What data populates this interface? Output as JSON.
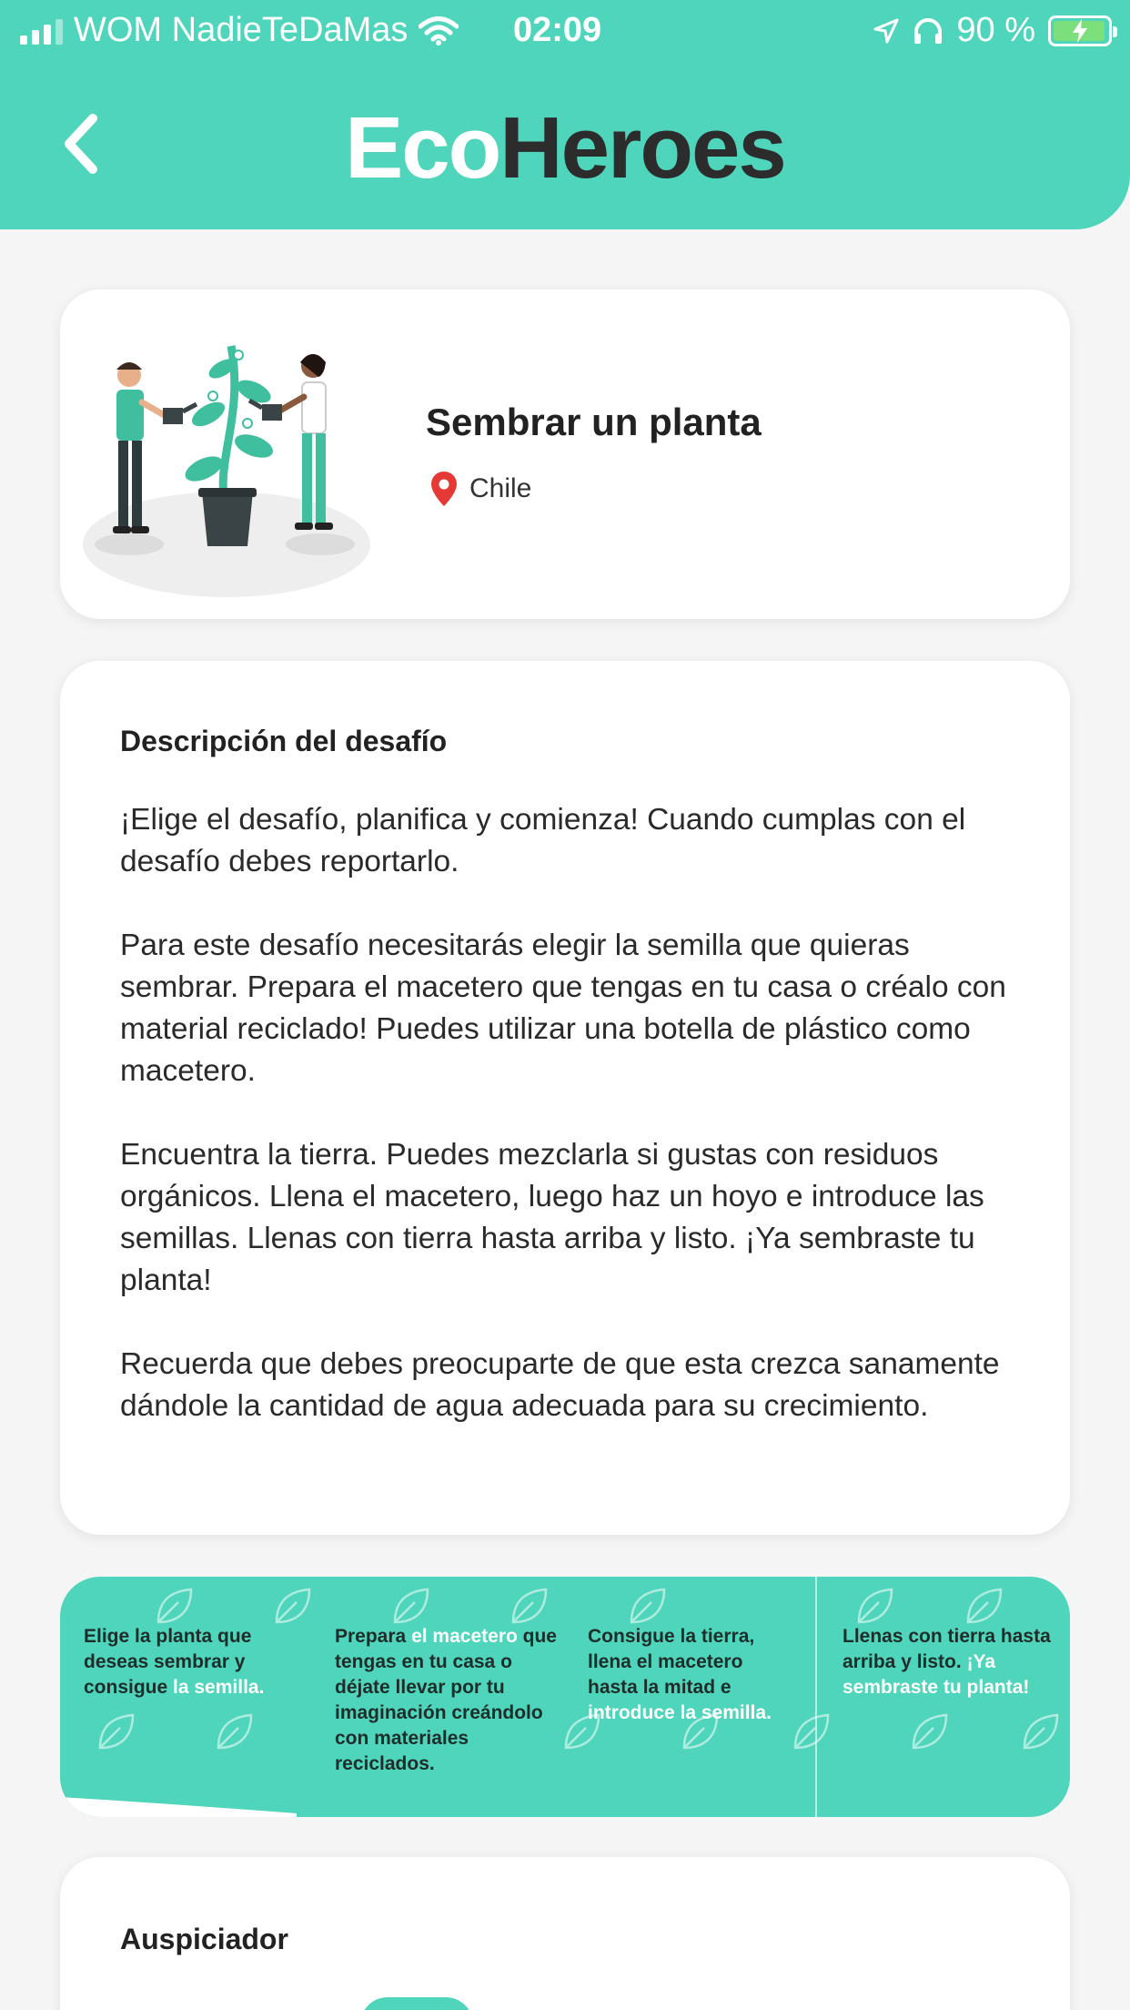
{
  "status_bar": {
    "carrier": "WOM NadieTeDaMas",
    "time": "02:09",
    "battery": "90 %",
    "icons": [
      "signal-icon",
      "wifi-icon",
      "location-arrow-icon",
      "headphones-icon",
      "battery-charging-icon"
    ]
  },
  "header": {
    "brand_part1": "Eco",
    "brand_part2": "Heroes",
    "back_icon": "chevron-left-icon",
    "colors": {
      "accent": "#4fd5bb",
      "brand_dark": "#2c2c2c"
    }
  },
  "challenge": {
    "title": "Sembrar un planta",
    "location": "Chile",
    "location_icon": "map-pin-icon",
    "location_icon_color": "#e53935"
  },
  "description": {
    "heading": "Descripción del desafío",
    "paragraphs": [
      "¡Elige el desafío, planifica y comienza! Cuando cumplas con el desafío debes reportarlo.",
      "Para este desafío necesitarás elegir la semilla que quieras sembrar. Prepara el macetero que tengas en tu casa o créalo con material reciclado! Puedes utilizar una botella de plástico como macetero.",
      "Encuentra la tierra. Puedes mezclarla si gustas con residuos orgánicos. Llena el macetero, luego haz un hoyo e introduce las semillas. Llenas con tierra hasta arriba y listo. ¡Ya sembraste tu planta!",
      "Recuerda que debes preocuparte de que esta crezca sanamente dándole la cantidad de agua adecuada para su crecimiento."
    ]
  },
  "steps": [
    {
      "pre": "Elige la planta que deseas sembrar y consigue ",
      "hl": "la semilla.",
      "post": ""
    },
    {
      "pre": "Prepara ",
      "hl": "el macetero",
      "post": " que tengas en tu casa o déjate llevar por tu imaginación creándolo con materiales reciclados."
    },
    {
      "pre": "Consigue la tierra, llena el macetero hasta la mitad e ",
      "hl": "introduce la semilla.",
      "post": ""
    },
    {
      "pre": "Llenas con tierra hasta arriba y listo. ",
      "hl": "¡Ya sembraste tu planta!",
      "post": ""
    }
  ],
  "sponsor": {
    "heading": "Auspiciador"
  }
}
